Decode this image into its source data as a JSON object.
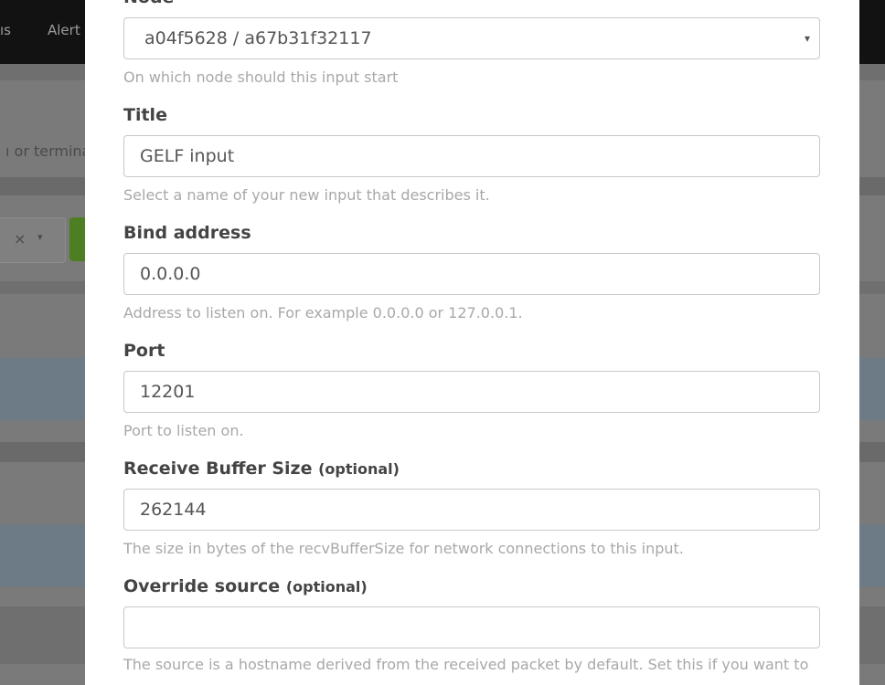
{
  "background": {
    "nav": {
      "item_partial_1": "ıs",
      "item_partial_2": "Alert"
    },
    "page_text_partial": "ı or termina",
    "filter": {
      "clear_symbol": "×",
      "caret_symbol": "▾"
    }
  },
  "form": {
    "node": {
      "label_partial": "Node",
      "selected_value": "a04f5628 / a67b31f32117",
      "help": "On which node should this input start"
    },
    "title": {
      "label": "Title",
      "value": "GELF input",
      "help": "Select a name of your new input that describes it."
    },
    "bind_address": {
      "label": "Bind address",
      "value": "0.0.0.0",
      "help": "Address to listen on. For example 0.0.0.0 or 127.0.0.1."
    },
    "port": {
      "label": "Port",
      "value": "12201",
      "help": "Port to listen on."
    },
    "recv_buffer": {
      "label": "Receive Buffer Size",
      "optional": "(optional)",
      "value": "262144",
      "help": "The size in bytes of the recvBufferSize for network connections to this input."
    },
    "override_source": {
      "label": "Override source",
      "optional": "(optional)",
      "value": "",
      "help_partial": "The source is a hostname derived from the received packet by default. Set this if you want to"
    }
  },
  "colors": {
    "overlay_bg": "#7a7a7a",
    "nav_bg": "#121212",
    "modal_bg": "#ffffff",
    "help_text": "#a8a8a8"
  }
}
